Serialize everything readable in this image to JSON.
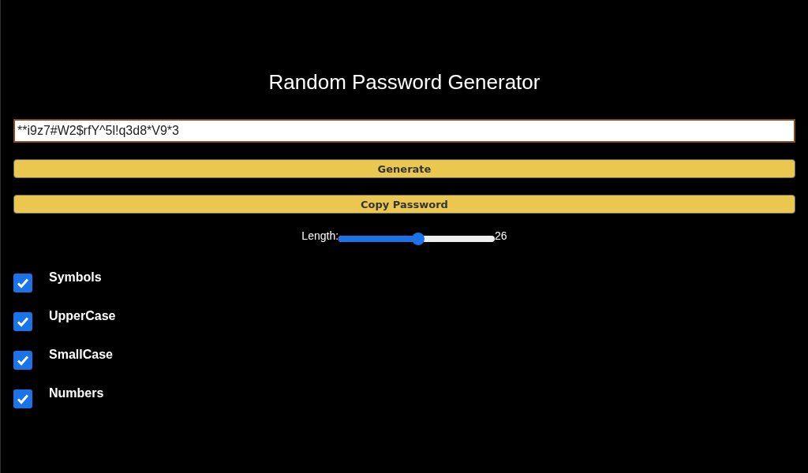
{
  "title": "Random Password Generator",
  "password": {
    "value": "**i9z7#W2$rfY^5l!q3d8*V9*3"
  },
  "buttons": [
    {
      "label": "Generate"
    },
    {
      "label": "Copy Password"
    }
  ],
  "length": {
    "label": "Length:",
    "level": 0.51,
    "reading": "26"
  },
  "options": [
    {
      "label": "Symbols",
      "checked": true
    },
    {
      "label": "UpperCase",
      "checked": true
    },
    {
      "label": "SmallCase",
      "checked": true
    },
    {
      "label": "Numbers",
      "checked": true
    }
  ]
}
